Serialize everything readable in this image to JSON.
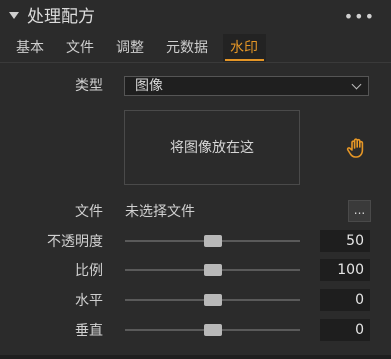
{
  "header": {
    "title": "处理配方",
    "menu_icon": "more-horizontal-icon"
  },
  "tabs": [
    {
      "label": "基本",
      "active": false
    },
    {
      "label": "文件",
      "active": false
    },
    {
      "label": "调整",
      "active": false
    },
    {
      "label": "元数据",
      "active": false
    },
    {
      "label": "水印",
      "active": true
    }
  ],
  "watermark": {
    "type_label": "类型",
    "type_value": "图像",
    "drop_text": "将图像放在这",
    "file_label": "文件",
    "file_value": "未选择文件",
    "browse_label": "...",
    "sliders": [
      {
        "label": "不透明度",
        "value": "50"
      },
      {
        "label": "比例",
        "value": "100"
      },
      {
        "label": "水平",
        "value": "0"
      },
      {
        "label": "垂直",
        "value": "0"
      }
    ]
  },
  "colors": {
    "accent": "#e59626"
  }
}
